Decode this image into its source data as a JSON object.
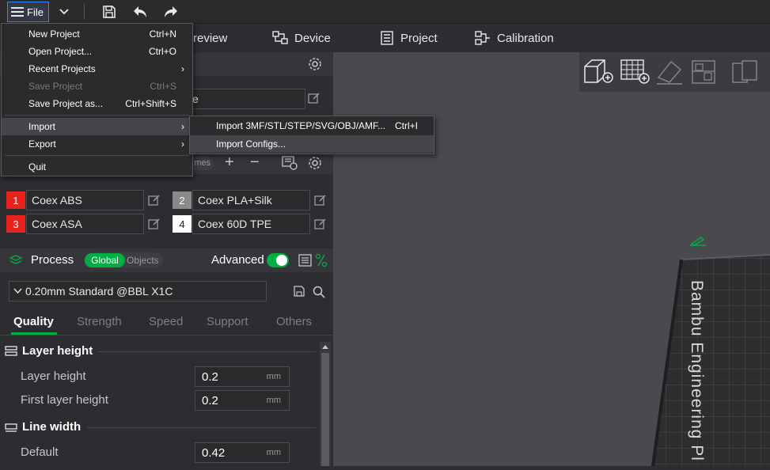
{
  "toolbar": {
    "file_label": "File"
  },
  "tabs": [
    {
      "label": "review",
      "icon": "preview-icon"
    },
    {
      "label": "Device",
      "icon": "device-icon"
    },
    {
      "label": "Project",
      "icon": "project-icon"
    },
    {
      "label": "Calibration",
      "icon": "calibration-icon"
    }
  ],
  "file_menu": {
    "items": [
      {
        "label": "New Project",
        "shortcut": "Ctrl+N"
      },
      {
        "label": "Open Project...",
        "shortcut": "Ctrl+O"
      },
      {
        "label": "Recent Projects",
        "shortcut": ""
      },
      {
        "label": "Save Project",
        "shortcut": "Ctrl+S"
      },
      {
        "label": "Save Project as...",
        "shortcut": "Ctrl+Shift+S"
      },
      {
        "label": "Import",
        "shortcut": ""
      },
      {
        "label": "Export",
        "shortcut": ""
      },
      {
        "label": "Quit",
        "shortcut": ""
      }
    ]
  },
  "import_submenu": {
    "items": [
      {
        "label": "Import 3MF/STL/STEP/SVG/OBJ/AMF...",
        "shortcut": "Ctrl+I"
      },
      {
        "label": "Import Configs...",
        "shortcut": ""
      }
    ]
  },
  "printer": {
    "plate_value": "e"
  },
  "filament": {
    "presets_badge": "mes",
    "slots": [
      {
        "num": "1",
        "name": "Coex ABS",
        "color": "#e8221c"
      },
      {
        "num": "2",
        "name": "Coex PLA+Silk",
        "color": "#8a8a8a"
      },
      {
        "num": "3",
        "name": "Coex ASA",
        "color": "#e8221c"
      },
      {
        "num": "4",
        "name": "Coex 60D TPE",
        "color": "#ffffff"
      }
    ]
  },
  "process": {
    "title": "Process",
    "toggle_global": "Global",
    "toggle_objects": "Objects",
    "advanced_label": "Advanced",
    "preset": "0.20mm Standard @BBL X1C",
    "tabs": [
      "Quality",
      "Strength",
      "Speed",
      "Support",
      "Others"
    ],
    "sections": {
      "layer_height": {
        "title": "Layer height",
        "rows": [
          {
            "label": "Layer height",
            "value": "0.2",
            "unit": "mm"
          },
          {
            "label": "First layer height",
            "value": "0.2",
            "unit": "mm"
          }
        ]
      },
      "line_width": {
        "title": "Line width",
        "rows": [
          {
            "label": "Default",
            "value": "0.42",
            "unit": "mm"
          }
        ]
      }
    }
  },
  "viewport": {
    "bed_text": "Bambu Engineering Pl"
  },
  "colors": {
    "accent": "#00ae42",
    "highlight": "#2f8cf0"
  }
}
